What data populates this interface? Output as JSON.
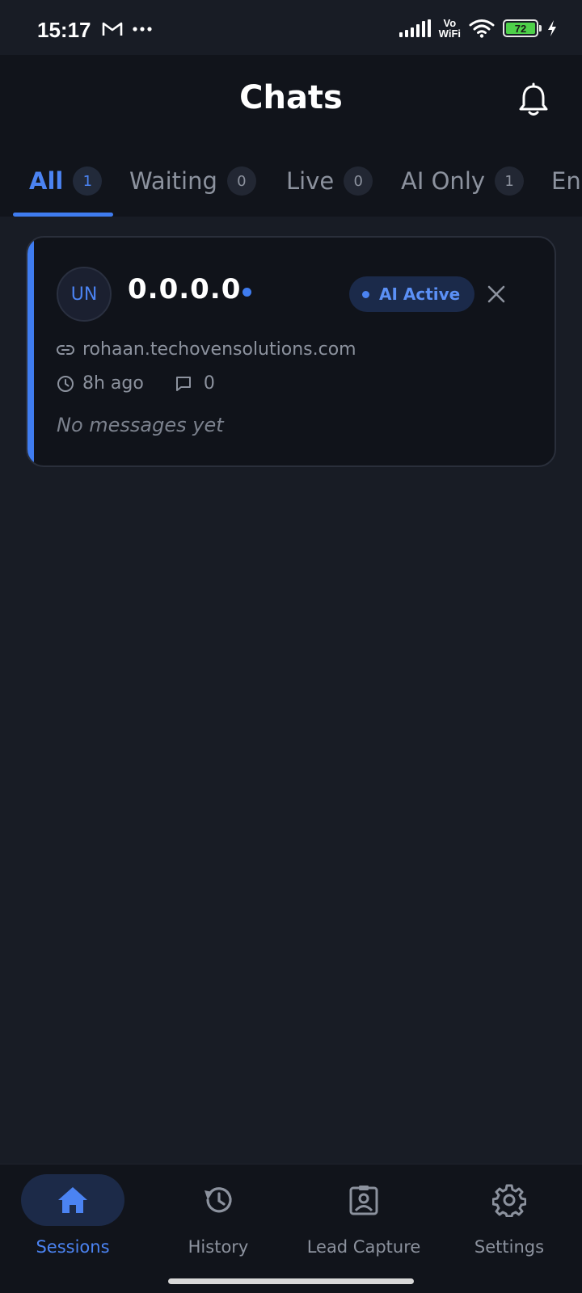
{
  "status_bar": {
    "time": "15:17",
    "vowifi_line1": "Vo",
    "vowifi_line2": "WiFi",
    "battery_level": "72"
  },
  "header": {
    "title": "Chats"
  },
  "tabs": [
    {
      "label": "All",
      "count": "1"
    },
    {
      "label": "Waiting",
      "count": "0"
    },
    {
      "label": "Live",
      "count": "0"
    },
    {
      "label": "AI Only",
      "count": "1"
    },
    {
      "label": "End"
    }
  ],
  "sessions": [
    {
      "avatar_initials": "UN",
      "title": "0.0.0.0",
      "status_badge": "AI Active",
      "url": "rohaan.techovensolutions.com",
      "time_ago": "8h ago",
      "message_count": "0",
      "preview": "No messages yet"
    }
  ],
  "bottom_nav": [
    {
      "label": "Sessions",
      "icon": "home-icon"
    },
    {
      "label": "History",
      "icon": "history-icon"
    },
    {
      "label": "Lead Capture",
      "icon": "lead-capture-icon"
    },
    {
      "label": "Settings",
      "icon": "gear-icon"
    }
  ],
  "colors": {
    "accent": "#3f7cf0",
    "background": "#181c25",
    "surface": "#11141b",
    "muted_text": "#8c929e"
  }
}
